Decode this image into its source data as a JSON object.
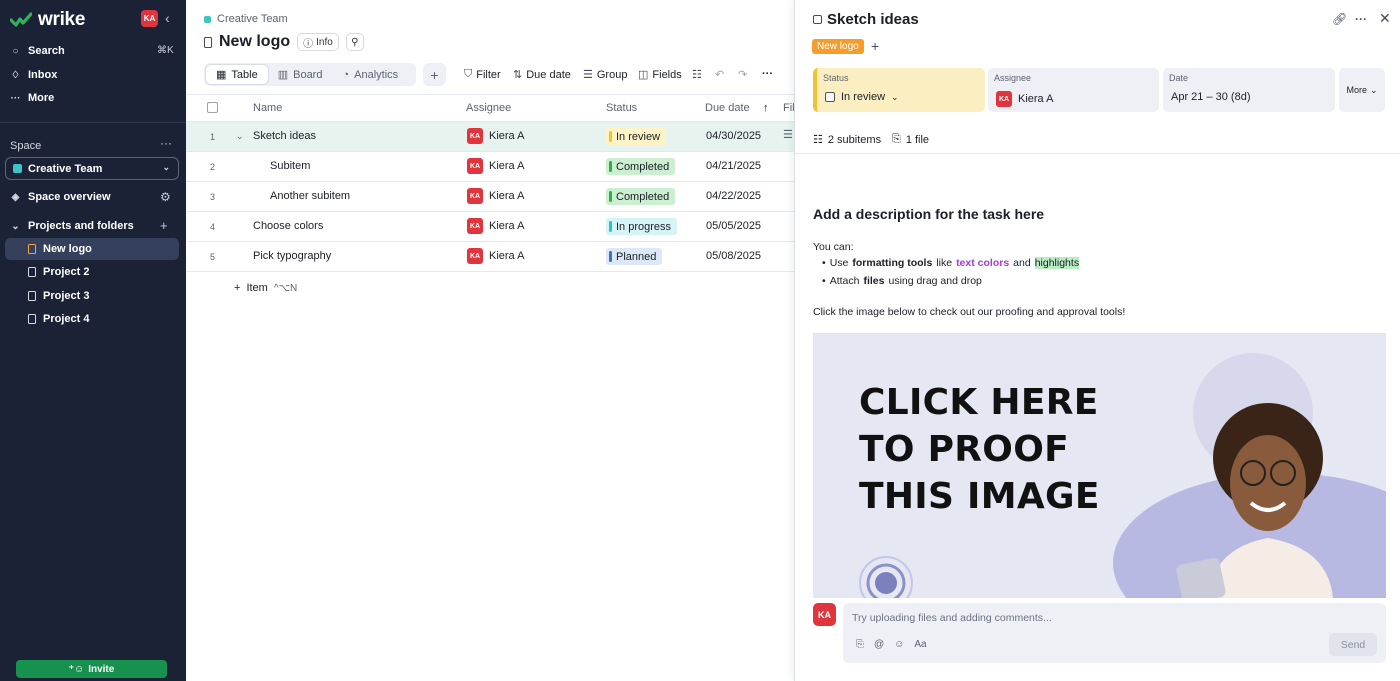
{
  "app": {
    "logo_text": "wrike",
    "user_initials": "KA"
  },
  "sidebar": {
    "nav": [
      {
        "label": "Search",
        "icon": "search-icon"
      },
      {
        "label": "Inbox",
        "icon": "bell-icon"
      },
      {
        "label": "More",
        "icon": "more-icon"
      }
    ],
    "search_shortcut": "⌘K",
    "space_label": "Space",
    "space_name": "Creative Team",
    "space_overview": "Space overview",
    "projects_label": "Projects and folders",
    "projects": [
      "New logo",
      "Project 2",
      "Project 3",
      "Project 4"
    ],
    "invite_label": "Invite"
  },
  "main": {
    "breadcrumb": "Creative Team",
    "title": "New logo",
    "info_label": "Info",
    "views": [
      "Table",
      "Board",
      "Analytics"
    ],
    "toolbar": {
      "filter": "Filter",
      "due_date": "Due date",
      "group": "Group",
      "fields": "Fields"
    },
    "columns": {
      "name": "Name",
      "assignee": "Assignee",
      "status": "Status",
      "due_date": "Due date",
      "files": "Fil"
    },
    "rows": [
      {
        "num": "1",
        "name": "Sketch ideas",
        "assignee": "Kiera A",
        "initials": "KA",
        "status": "In review",
        "due": "04/30/2025"
      },
      {
        "num": "2",
        "name": "Subitem",
        "assignee": "Kiera A",
        "initials": "KA",
        "status": "Completed",
        "due": "04/21/2025"
      },
      {
        "num": "3",
        "name": "Another subitem",
        "assignee": "Kiera A",
        "initials": "KA",
        "status": "Completed",
        "due": "04/22/2025"
      },
      {
        "num": "4",
        "name": "Choose colors",
        "assignee": "Kiera A",
        "initials": "KA",
        "status": "In progress",
        "due": "05/05/2025"
      },
      {
        "num": "5",
        "name": "Pick typography",
        "assignee": "Kiera A",
        "initials": "KA",
        "status": "Planned",
        "due": "05/08/2025"
      }
    ],
    "add_item": "Item",
    "add_item_shortcut": "^⌥N"
  },
  "status_colors": {
    "In review": {
      "bg": "#fdf3c6",
      "bar": "#f2c12e"
    },
    "Completed": {
      "bg": "#ccefd1",
      "bar": "#2fae4e"
    },
    "In progress": {
      "bg": "#d6f3f6",
      "bar": "#2cc3cf"
    },
    "Planned": {
      "bg": "#dce8f8",
      "bar": "#3b6fd0"
    }
  },
  "panel": {
    "title": "Sketch ideas",
    "tag": "New logo",
    "fields": {
      "status_label": "Status",
      "status_value": "In review",
      "assignee_label": "Assignee",
      "assignee_value": "Kiera A",
      "date_label": "Date",
      "date_value": "Apr 21 – 30 (8d)",
      "more": "More"
    },
    "subitems": "2 subitems",
    "files": "1 file",
    "description_heading": "Add a description for the task here",
    "you_can": "You can:",
    "bullet1": {
      "pre": "Use",
      "b1": "formatting tools",
      "mid": "like",
      "c": "text colors",
      "and": "and",
      "h": "highlights"
    },
    "bullet2": {
      "pre": "Attach",
      "b": "files",
      "post": "using drag and drop"
    },
    "click_text": "Click the image below to check out our proofing and approval tools!",
    "promo_lines": [
      "CLICK HERE",
      "TO PROOF",
      "THIS IMAGE"
    ],
    "comment_placeholder": "Try uploading files and adding comments...",
    "comment_tools": [
      "attach-icon",
      "mention-icon",
      "emoji-icon",
      "Aa"
    ],
    "send": "Send"
  }
}
